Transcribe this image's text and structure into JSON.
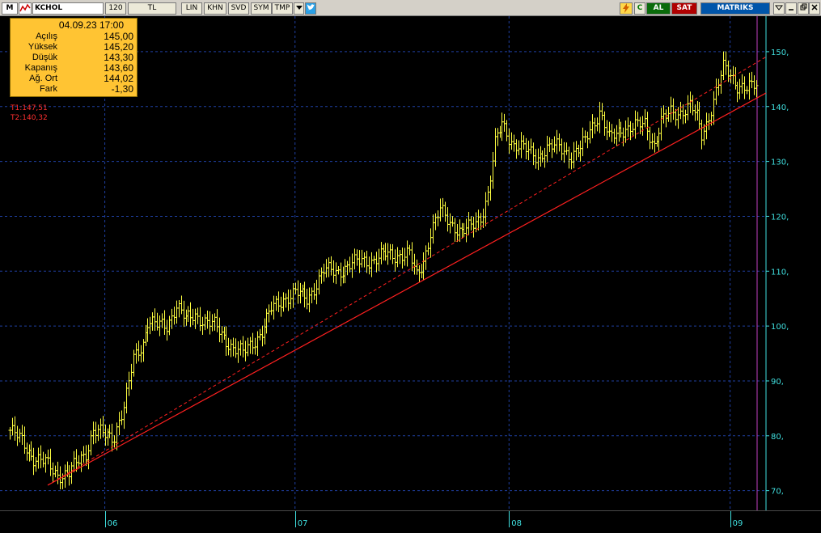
{
  "toolbar": {
    "m_label": "M",
    "symbol": "KCHOL",
    "period": "120",
    "currency": "TL",
    "buttons": [
      "LIN",
      "KHN",
      "SVD",
      "SYM",
      "TMP"
    ],
    "lightning_icon": "lightning-icon",
    "refresh_label": "C",
    "buy_label": "AL",
    "sell_label": "SAT",
    "brand": "MATRIKS"
  },
  "info": {
    "date": "04.09.23 17:00",
    "rows": [
      {
        "label": "Açılış",
        "value": "145,00"
      },
      {
        "label": "Yüksek",
        "value": "145,20"
      },
      {
        "label": "Düşük",
        "value": "143,30"
      },
      {
        "label": "Kapanış",
        "value": "143,60"
      },
      {
        "label": "Ağ. Ort",
        "value": "144,02"
      },
      {
        "label": "Fark",
        "value": "-1,30"
      }
    ]
  },
  "trendlines": {
    "t1": "T1:147,51",
    "t2": "T2:140,32"
  },
  "colors": {
    "bars": "#ffff40",
    "axis_text": "#40e0e0",
    "grid": "#1f3fa0",
    "trend": "#ff2020",
    "info_bg": "#ffc433"
  },
  "chart_data": {
    "type": "ohlc",
    "title": "",
    "xlabel": "",
    "ylabel": "",
    "ylim": [
      67,
      155
    ],
    "y_ticks": [
      "70,",
      "80,",
      "90,",
      "100,",
      "110,",
      "120,",
      "130,",
      "140,",
      "150,"
    ],
    "y_tick_values": [
      70,
      80,
      90,
      100,
      110,
      120,
      130,
      140,
      150
    ],
    "x_ticks": [
      "06",
      "07",
      "08",
      "09"
    ],
    "x_tick_index": [
      40,
      120,
      210,
      303
    ],
    "n_bars": 315,
    "grid": true,
    "close_anchors": [
      [
        0,
        81
      ],
      [
        5,
        79
      ],
      [
        10,
        76
      ],
      [
        15,
        75
      ],
      [
        20,
        73
      ],
      [
        25,
        73
      ],
      [
        28,
        75
      ],
      [
        32,
        77
      ],
      [
        35,
        81
      ],
      [
        40,
        80
      ],
      [
        44,
        80
      ],
      [
        46,
        83
      ],
      [
        48,
        85
      ],
      [
        52,
        94
      ],
      [
        56,
        97
      ],
      [
        58,
        101
      ],
      [
        62,
        100
      ],
      [
        66,
        100
      ],
      [
        70,
        104
      ],
      [
        74,
        101
      ],
      [
        78,
        102
      ],
      [
        82,
        101
      ],
      [
        86,
        100
      ],
      [
        90,
        98
      ],
      [
        94,
        96
      ],
      [
        98,
        95
      ],
      [
        102,
        97
      ],
      [
        106,
        99
      ],
      [
        110,
        103
      ],
      [
        115,
        105
      ],
      [
        120,
        106
      ],
      [
        125,
        105
      ],
      [
        128,
        107
      ],
      [
        132,
        110
      ],
      [
        138,
        110
      ],
      [
        143,
        111
      ],
      [
        148,
        112
      ],
      [
        153,
        112
      ],
      [
        158,
        113
      ],
      [
        163,
        113
      ],
      [
        168,
        113
      ],
      [
        171,
        109
      ],
      [
        174,
        112
      ],
      [
        177,
        117
      ],
      [
        181,
        121
      ],
      [
        185,
        119
      ],
      [
        190,
        117
      ],
      [
        194,
        118
      ],
      [
        198,
        120
      ],
      [
        201,
        124
      ],
      [
        204,
        133
      ],
      [
        207,
        137
      ],
      [
        212,
        133
      ],
      [
        217,
        132
      ],
      [
        222,
        131
      ],
      [
        226,
        132
      ],
      [
        231,
        133
      ],
      [
        236,
        131
      ],
      [
        240,
        132
      ],
      [
        244,
        136
      ],
      [
        248,
        139
      ],
      [
        252,
        134
      ],
      [
        257,
        136
      ],
      [
        262,
        136
      ],
      [
        267,
        137
      ],
      [
        271,
        133
      ],
      [
        274,
        137
      ],
      [
        278,
        139
      ],
      [
        282,
        139
      ],
      [
        286,
        140
      ],
      [
        289,
        138
      ],
      [
        291,
        135
      ],
      [
        293,
        137
      ],
      [
        296,
        141
      ],
      [
        300,
        147
      ],
      [
        303,
        146
      ],
      [
        306,
        144
      ],
      [
        310,
        143
      ],
      [
        314,
        144
      ]
    ],
    "trendline_solid": {
      "from": [
        16,
        71
      ],
      "to": [
        314,
        141.5
      ]
    },
    "trendline_dashed": {
      "from": [
        16,
        71
      ],
      "to": [
        314,
        148
      ]
    }
  }
}
